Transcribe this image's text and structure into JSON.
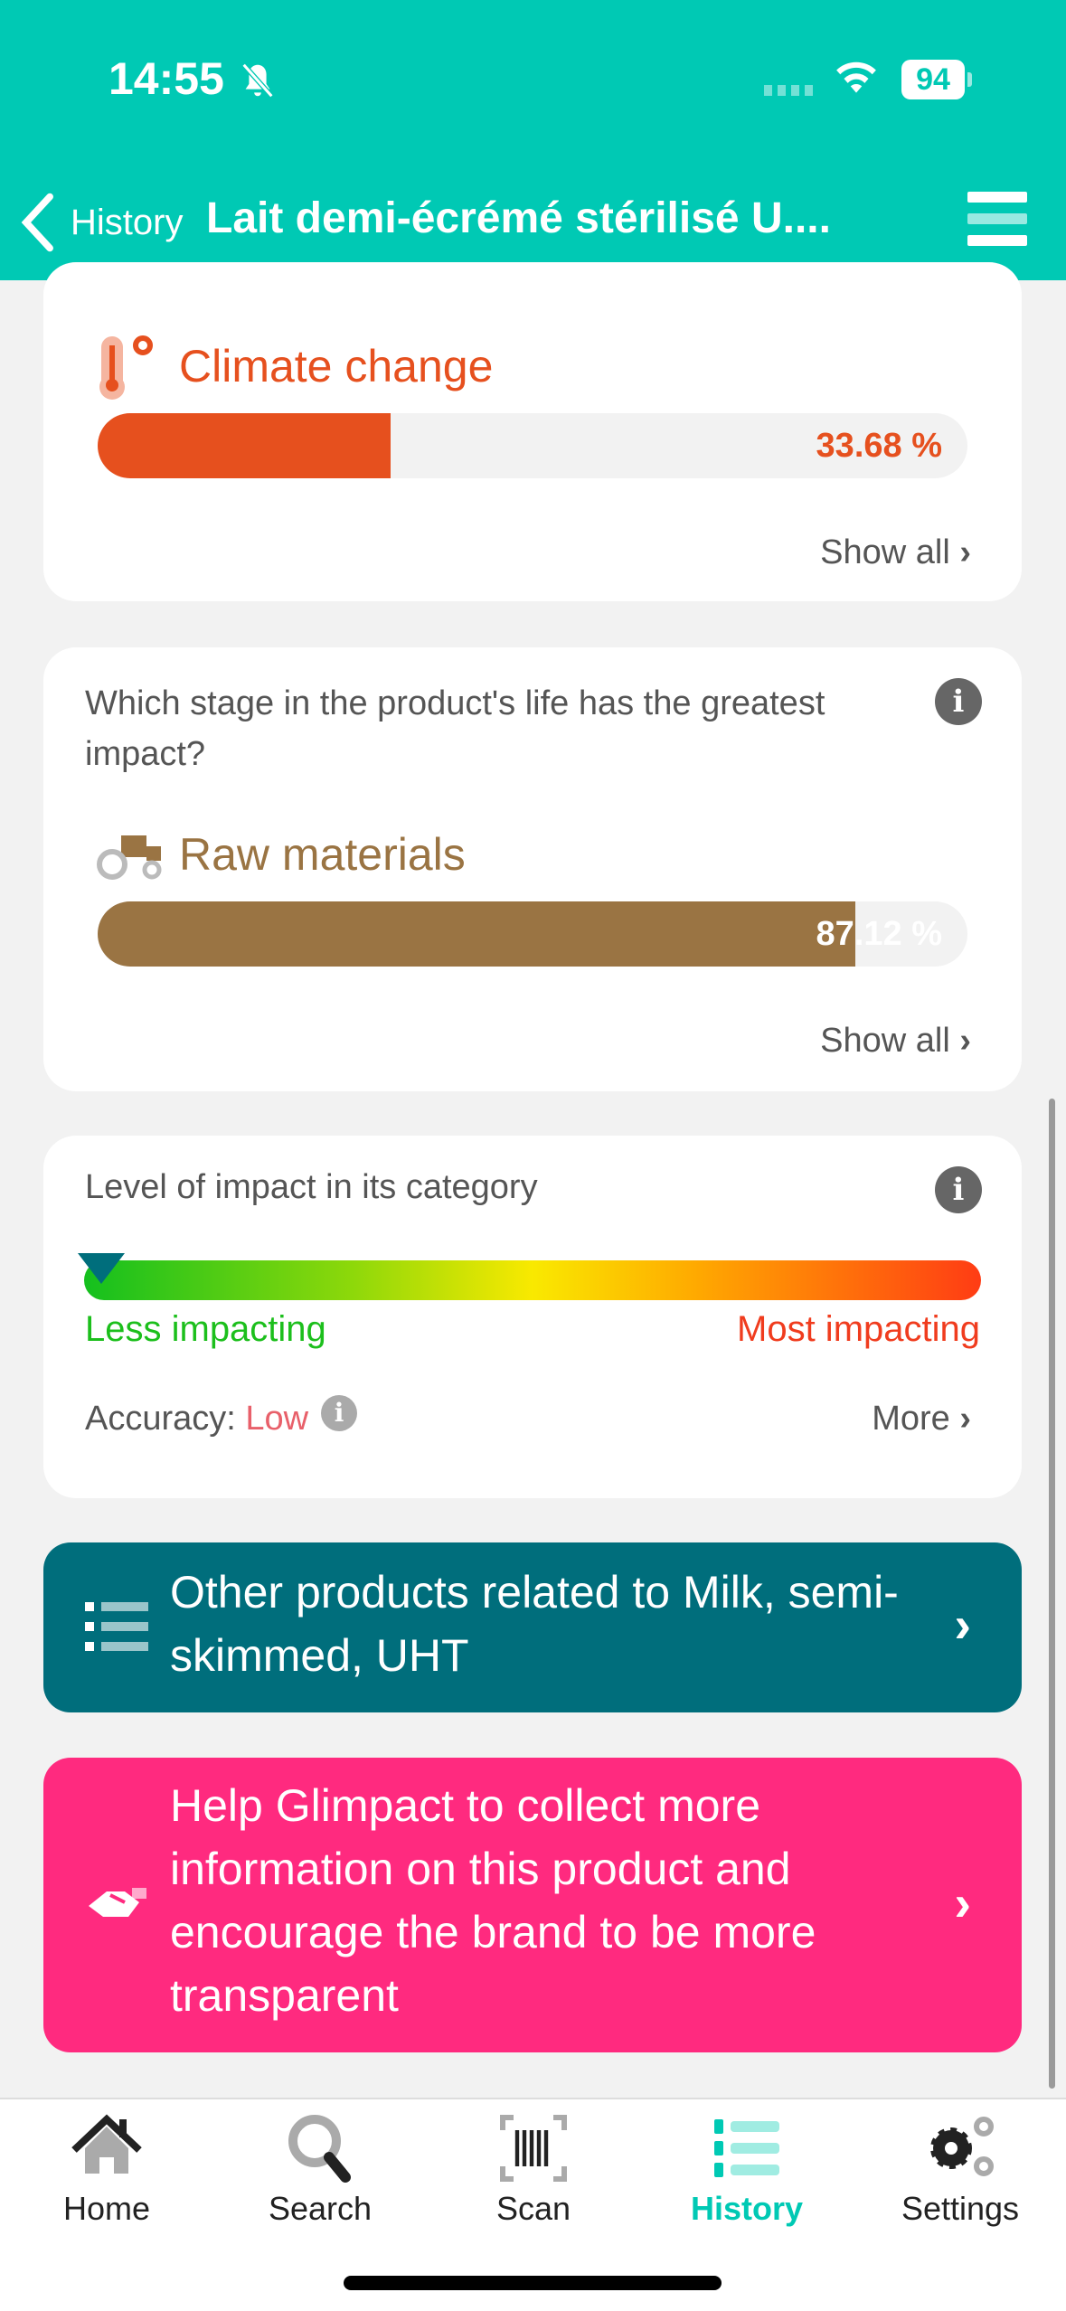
{
  "status_bar": {
    "time": "14:55",
    "battery": "94",
    "icons": [
      "bell-slash-icon",
      "cellular-icon",
      "wifi-icon",
      "battery-icon"
    ]
  },
  "header": {
    "back_label": "History",
    "title": "Lait demi-écrémé stérilisé U....",
    "menu_icon": "hamburger-icon"
  },
  "climate_card": {
    "title": "Climate change",
    "percent_label": "33.68 %",
    "percent": 33.68,
    "show_all": "Show all",
    "color": "#e6501e"
  },
  "stage_card": {
    "question": "Which stage in the product's life has the greatest impact?",
    "title": "Raw materials",
    "percent_label": "87.12 %",
    "percent": 87.12,
    "show_all": "Show all",
    "color": "#9a7443"
  },
  "level_card": {
    "title": "Level of impact in its category",
    "less": "Less impacting",
    "most": "Most impacting",
    "accuracy_label": "Accuracy:",
    "accuracy_value": "Low",
    "more": "More",
    "marker_position_percent": 2
  },
  "related_button": {
    "label": "Other products related to Milk, semi-skimmed, UHT",
    "color": "#006e7c"
  },
  "help_button": {
    "label": "Help Glimpact to collect more information on this product and encourage the brand to be more transparent",
    "color": "#ff2a7f"
  },
  "tabbar": {
    "items": [
      {
        "label": "Home",
        "icon": "home-icon"
      },
      {
        "label": "Search",
        "icon": "search-icon"
      },
      {
        "label": "Scan",
        "icon": "barcode-icon"
      },
      {
        "label": "History",
        "icon": "list-icon",
        "active": true
      },
      {
        "label": "Settings",
        "icon": "gears-icon"
      }
    ],
    "active_color": "#00c9b4"
  }
}
